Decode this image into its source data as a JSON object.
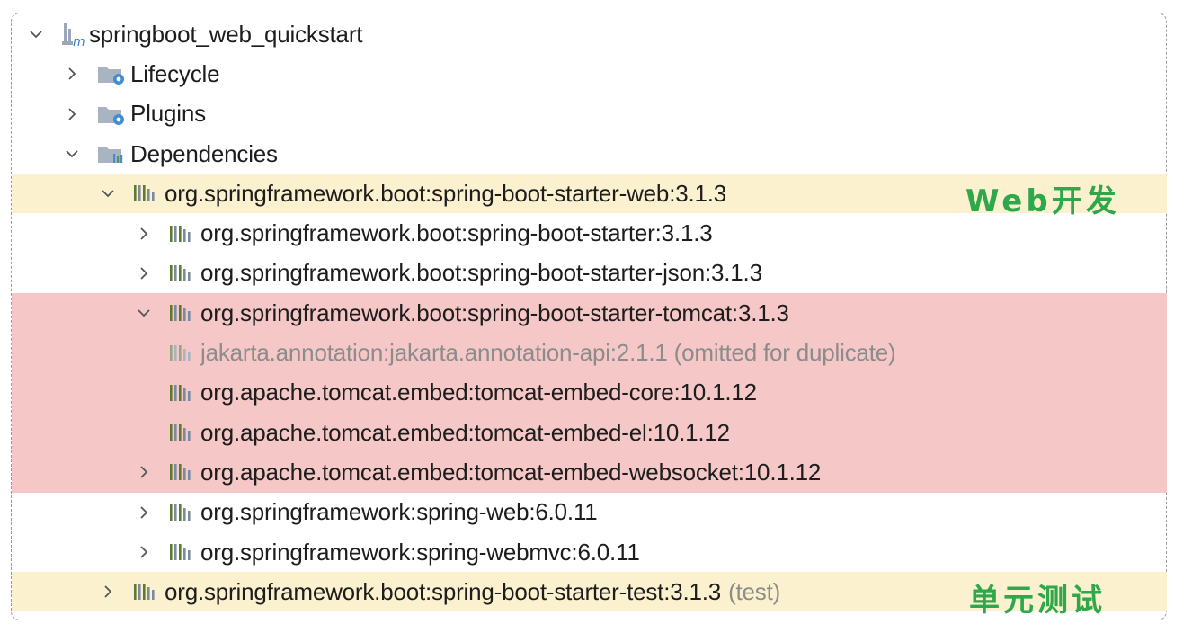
{
  "tree": {
    "root": {
      "label": "springboot_web_quickstart",
      "icon": "maven-module-icon",
      "expanded": true
    },
    "lifecycle": {
      "label": "Lifecycle",
      "icon": "folder-gear-icon",
      "expanded": false
    },
    "plugins": {
      "label": "Plugins",
      "icon": "folder-gear-icon",
      "expanded": false
    },
    "dependencies": {
      "label": "Dependencies",
      "icon": "folder-library-icon",
      "expanded": true
    },
    "items": [
      {
        "label": "org.springframework.boot:spring-boot-starter-web:3.1.3",
        "suffix": "",
        "icon": "library-icon",
        "expanded": true,
        "highlight": "yellow"
      },
      {
        "label": "org.springframework.boot:spring-boot-starter:3.1.3",
        "suffix": "",
        "icon": "library-icon",
        "expanded": false,
        "highlight": ""
      },
      {
        "label": "org.springframework.boot:spring-boot-starter-json:3.1.3",
        "suffix": "",
        "icon": "library-icon",
        "expanded": false,
        "highlight": ""
      },
      {
        "label": "org.springframework.boot:spring-boot-starter-tomcat:3.1.3",
        "suffix": "",
        "icon": "library-icon",
        "expanded": true,
        "highlight": "red"
      },
      {
        "label": "jakarta.annotation:jakarta.annotation-api:2.1.1 (omitted for duplicate)",
        "suffix": "",
        "icon": "library-icon",
        "expanded": null,
        "highlight": "red",
        "muted": true
      },
      {
        "label": "org.apache.tomcat.embed:tomcat-embed-core:10.1.12",
        "suffix": "",
        "icon": "library-icon",
        "expanded": null,
        "highlight": "red"
      },
      {
        "label": "org.apache.tomcat.embed:tomcat-embed-el:10.1.12",
        "suffix": "",
        "icon": "library-icon",
        "expanded": null,
        "highlight": "red"
      },
      {
        "label": "org.apache.tomcat.embed:tomcat-embed-websocket:10.1.12",
        "suffix": "",
        "icon": "library-icon",
        "expanded": false,
        "highlight": "red"
      },
      {
        "label": "org.springframework:spring-web:6.0.11",
        "suffix": "",
        "icon": "library-icon",
        "expanded": false,
        "highlight": ""
      },
      {
        "label": "org.springframework:spring-webmvc:6.0.11",
        "suffix": "",
        "icon": "library-icon",
        "expanded": false,
        "highlight": ""
      },
      {
        "label": "org.springframework.boot:spring-boot-starter-test:3.1.3",
        "suffix": "(test)",
        "icon": "library-icon",
        "expanded": false,
        "highlight": "yellow"
      }
    ]
  },
  "annotations": {
    "web": "Web开发",
    "test": "单元测试"
  },
  "colors": {
    "highlight_yellow": "#fbf1cf",
    "highlight_red": "#f5c7c7",
    "annotation_green": "#2ea84a",
    "muted_text": "#8c8c8c"
  }
}
